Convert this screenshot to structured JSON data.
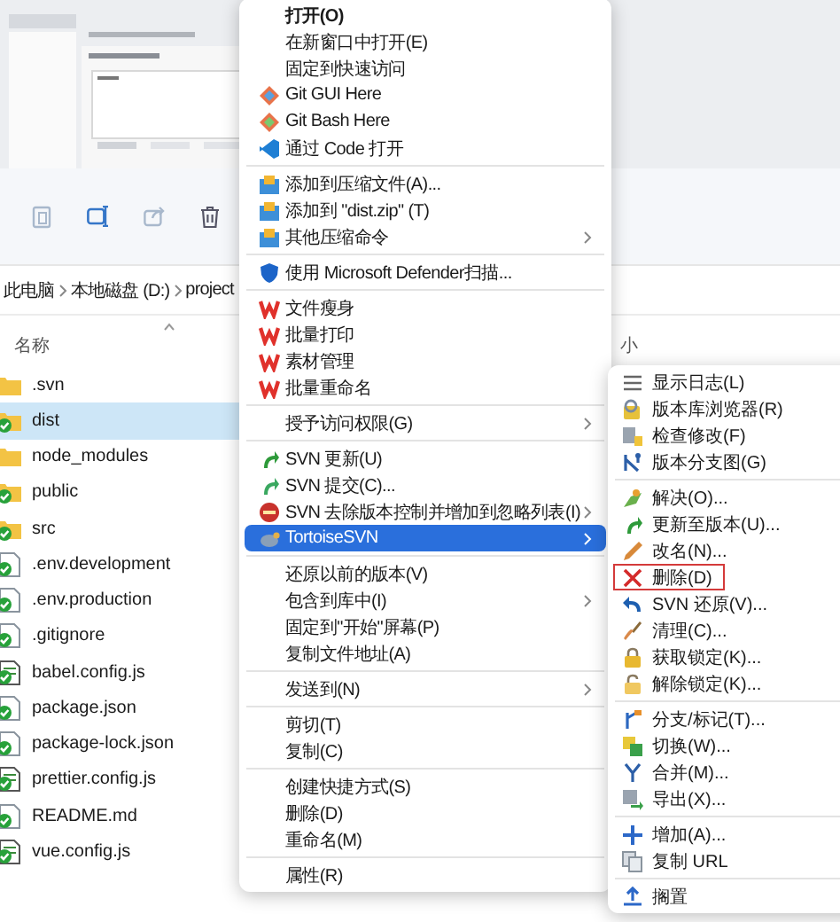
{
  "preview": {
    "kind": "picture"
  },
  "breadcrumb": [
    "此电脑",
    "本地磁盘 (D:)",
    "project"
  ],
  "columns": [
    "名称",
    "小"
  ],
  "files": [
    {
      "name": ".svn",
      "kind": "folder",
      "versioned": false,
      "selected": false
    },
    {
      "name": "dist",
      "kind": "folder",
      "versioned": true,
      "selected": true
    },
    {
      "name": "node_modules",
      "kind": "folder",
      "versioned": false,
      "selected": false
    },
    {
      "name": "public",
      "kind": "folder",
      "versioned": true,
      "selected": false
    },
    {
      "name": "src",
      "kind": "folder",
      "versioned": true,
      "selected": false
    },
    {
      "name": ".env.development",
      "kind": "file",
      "versioned": true,
      "selected": false
    },
    {
      "name": ".env.production",
      "kind": "file",
      "versioned": true,
      "selected": false
    },
    {
      "name": ".gitignore",
      "kind": "file",
      "versioned": true,
      "selected": false
    },
    {
      "name": "babel.config.js",
      "kind": "script",
      "versioned": true,
      "selected": false
    },
    {
      "name": "package.json",
      "kind": "file",
      "versioned": true,
      "selected": false
    },
    {
      "name": "package-lock.json",
      "kind": "file",
      "versioned": true,
      "selected": false
    },
    {
      "name": "prettier.config.js",
      "kind": "script",
      "versioned": true,
      "selected": false
    },
    {
      "name": "README.md",
      "kind": "file",
      "versioned": true,
      "selected": false
    },
    {
      "name": "vue.config.js",
      "kind": "script",
      "versioned": true,
      "selected": false
    }
  ],
  "context_menu": {
    "groups": [
      [
        {
          "label": "打开(O)",
          "default": true,
          "submenu": false,
          "selected": false
        },
        {
          "label": "在新窗口中打开(E)",
          "default": false,
          "submenu": false,
          "selected": false
        },
        {
          "label": "固定到快速访问",
          "default": false,
          "submenu": false,
          "selected": false
        },
        {
          "label": "Git GUI Here",
          "default": false,
          "submenu": false,
          "selected": false
        },
        {
          "label": "Git Bash Here",
          "default": false,
          "submenu": false,
          "selected": false
        },
        {
          "label": "通过 Code 打开",
          "default": false,
          "submenu": false,
          "selected": false
        }
      ],
      [
        {
          "label": "添加到压缩文件(A)...",
          "default": false,
          "submenu": false,
          "selected": false
        },
        {
          "label": "添加到 \"dist.zip\" (T)",
          "default": false,
          "submenu": false,
          "selected": false
        },
        {
          "label": "其他压缩命令",
          "default": false,
          "submenu": true,
          "selected": false
        }
      ],
      [
        {
          "label": "使用 Microsoft Defender扫描...",
          "default": false,
          "submenu": false,
          "selected": false
        }
      ],
      [
        {
          "label": "文件瘦身",
          "default": false,
          "submenu": false,
          "selected": false
        },
        {
          "label": "批量打印",
          "default": false,
          "submenu": false,
          "selected": false
        },
        {
          "label": "素材管理",
          "default": false,
          "submenu": false,
          "selected": false
        },
        {
          "label": "批量重命名",
          "default": false,
          "submenu": false,
          "selected": false
        }
      ],
      [
        {
          "label": "授予访问权限(G)",
          "default": false,
          "submenu": true,
          "selected": false
        }
      ],
      [
        {
          "label": "SVN 更新(U)",
          "default": false,
          "submenu": false,
          "selected": false
        },
        {
          "label": "SVN 提交(C)...",
          "default": false,
          "submenu": false,
          "selected": false
        },
        {
          "label": "SVN 去除版本控制并增加到忽略列表(I)",
          "default": false,
          "submenu": true,
          "selected": false
        },
        {
          "label": "TortoiseSVN",
          "default": false,
          "submenu": true,
          "selected": true
        }
      ],
      [
        {
          "label": "还原以前的版本(V)",
          "default": false,
          "submenu": false,
          "selected": false
        },
        {
          "label": "包含到库中(I)",
          "default": false,
          "submenu": true,
          "selected": false
        },
        {
          "label": "固定到\"开始\"屏幕(P)",
          "default": false,
          "submenu": false,
          "selected": false
        },
        {
          "label": "复制文件地址(A)",
          "default": false,
          "submenu": false,
          "selected": false
        }
      ],
      [
        {
          "label": "发送到(N)",
          "default": false,
          "submenu": true,
          "selected": false
        }
      ],
      [
        {
          "label": "剪切(T)",
          "default": false,
          "submenu": false,
          "selected": false
        },
        {
          "label": "复制(C)",
          "default": false,
          "submenu": false,
          "selected": false
        }
      ],
      [
        {
          "label": "创建快捷方式(S)",
          "default": false,
          "submenu": false,
          "selected": false
        },
        {
          "label": "删除(D)",
          "default": false,
          "submenu": false,
          "selected": false
        },
        {
          "label": "重命名(M)",
          "default": false,
          "submenu": false,
          "selected": false
        }
      ],
      [
        {
          "label": "属性(R)",
          "default": false,
          "submenu": false,
          "selected": false
        }
      ]
    ]
  },
  "svn_submenu": {
    "groups": [
      [
        {
          "label": "显示日志(L)",
          "marked": false
        },
        {
          "label": "版本库浏览器(R)",
          "marked": false
        },
        {
          "label": "检查修改(F)",
          "marked": false
        },
        {
          "label": "版本分支图(G)",
          "marked": false
        }
      ],
      [
        {
          "label": "解决(O)...",
          "marked": false
        },
        {
          "label": "更新至版本(U)...",
          "marked": false
        },
        {
          "label": "改名(N)...",
          "marked": false
        },
        {
          "label": "删除(D)",
          "marked": true
        },
        {
          "label": "SVN 还原(V)...",
          "marked": false
        },
        {
          "label": "清理(C)...",
          "marked": false
        },
        {
          "label": "获取锁定(K)...",
          "marked": false
        },
        {
          "label": "解除锁定(K)...",
          "marked": false
        }
      ],
      [
        {
          "label": "分支/标记(T)...",
          "marked": false
        },
        {
          "label": "切换(W)...",
          "marked": false
        },
        {
          "label": "合并(M)...",
          "marked": false
        },
        {
          "label": "导出(X)...",
          "marked": false
        }
      ],
      [
        {
          "label": "增加(A)...",
          "marked": false
        },
        {
          "label": "复制 URL",
          "marked": false
        }
      ],
      [
        {
          "label": "搁置",
          "marked": false
        }
      ]
    ]
  }
}
